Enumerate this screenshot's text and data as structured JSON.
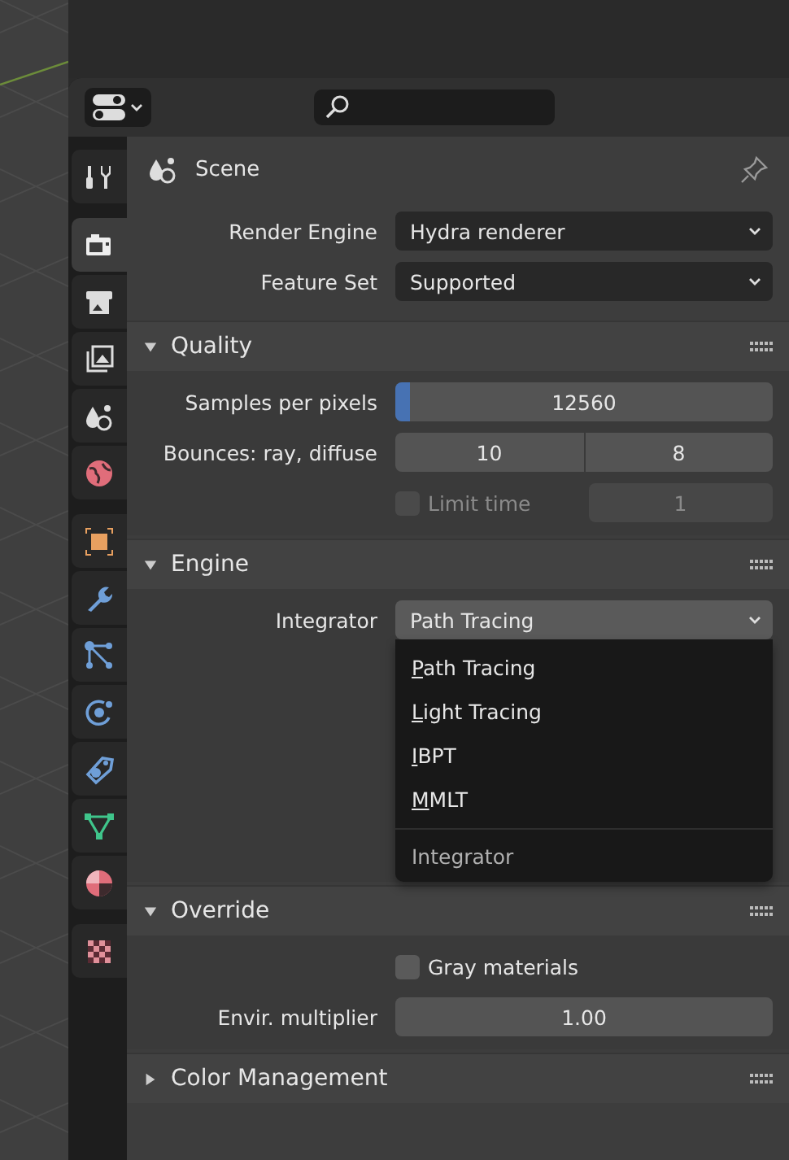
{
  "tab_groups": [
    [
      {
        "kind": "tool",
        "selected": false
      }
    ],
    [
      {
        "kind": "render",
        "selected": true
      },
      {
        "kind": "output",
        "selected": false
      },
      {
        "kind": "view_layer",
        "selected": false
      },
      {
        "kind": "scene",
        "selected": false
      },
      {
        "kind": "world",
        "selected": false
      }
    ],
    [
      {
        "kind": "object",
        "selected": false
      },
      {
        "kind": "modifiers",
        "selected": false
      },
      {
        "kind": "particles",
        "selected": false
      },
      {
        "kind": "physics",
        "selected": false
      },
      {
        "kind": "constraints",
        "selected": false
      },
      {
        "kind": "data",
        "selected": false
      },
      {
        "kind": "material",
        "selected": false
      }
    ],
    [
      {
        "kind": "texture",
        "selected": false
      }
    ]
  ],
  "context": {
    "title": "Scene"
  },
  "properties": [
    {
      "label": "Render Engine",
      "value": "Hydra renderer"
    },
    {
      "label": "Feature Set",
      "value": "Supported"
    }
  ],
  "panels": [
    {
      "title": "Quality",
      "expanded": true,
      "rows": [
        {
          "kind": "slider",
          "label": "Samples per pixels",
          "value": "12560",
          "level": 0.04
        },
        {
          "kind": "pair",
          "label": "Bounces: ray, diffuse",
          "values": [
            "10",
            "8"
          ]
        },
        {
          "kind": "check_number",
          "check_label": "Limit time",
          "checked": false,
          "disabled": true,
          "value": "1"
        }
      ]
    },
    {
      "title": "Engine",
      "expanded": true,
      "rows": [
        {
          "kind": "dropdown",
          "label": "Integrator",
          "value": "Path Tracing",
          "open": true,
          "menu": {
            "items": [
              "Path Tracing",
              "Light Tracing",
              "IBPT",
              "MMLT"
            ],
            "footer": "Integrator"
          }
        }
      ]
    },
    {
      "title": "Override",
      "expanded": true,
      "rows": [
        {
          "kind": "check",
          "check_label": "Gray materials",
          "checked": false,
          "disabled": false
        },
        {
          "kind": "number",
          "label": "Envir. multiplier",
          "value": "1.00"
        }
      ]
    },
    {
      "title": "Color Management",
      "expanded": false
    }
  ]
}
